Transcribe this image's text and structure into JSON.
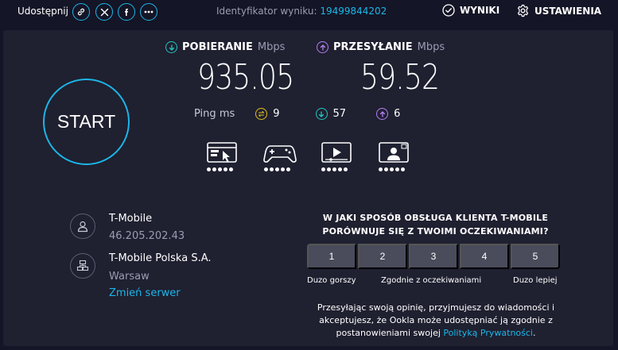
{
  "topbar": {
    "share_label": "Udostępnij",
    "share_icons": [
      "link-icon",
      "x-icon",
      "facebook-icon",
      "more-icon"
    ],
    "result_id_label": "Identyfikator wyniku:",
    "result_id_value": "19499844202",
    "results_label": "WYNIKI",
    "settings_label": "USTAWIENIA"
  },
  "start": {
    "label": "START"
  },
  "download": {
    "label": "POBIERANIE",
    "unit": "Mbps",
    "value": "935.05"
  },
  "upload": {
    "label": "PRZESYŁANIE",
    "unit": "Mbps",
    "value": "59.52"
  },
  "ping": {
    "label": "Ping",
    "unit": "ms",
    "idle": "9",
    "download": "57",
    "upload": "6"
  },
  "app_icons": [
    "browsing-icon",
    "gaming-icon",
    "video-streaming-icon",
    "video-chat-icon"
  ],
  "isp": {
    "provider": "T-Mobile",
    "ip": "46.205.202.43",
    "server_name": "T-Mobile Polska S.A.",
    "server_location": "Warsaw",
    "change_server": "Zmień serwer"
  },
  "survey": {
    "question": "W JAKI SPOSÓB OBSŁUGA KLIENTA T-MOBILE PORÓWNUJE SIĘ Z TWOIMI OCZEKIWANIAMI?",
    "options": [
      "1",
      "2",
      "3",
      "4",
      "5"
    ],
    "label_low": "Duzo gorszy",
    "label_mid": "Zgodnie z oczekiwaniami",
    "label_high": "Duzo lepiej",
    "consent_text": "Przesyłając swoją opinię, przyjmujesz do wiadomości i akceptujesz, że Ookla może udostępniać ją zgodnie z postanowieniami swojej",
    "consent_link": "Polityką Prywatności",
    "consent_end": "."
  },
  "colors": {
    "background": "#141526",
    "panel": "#1f2030",
    "accent": "#1cb6e8",
    "download": "#22c5c1",
    "upload": "#b47ef2",
    "ping": "#e3c022"
  }
}
